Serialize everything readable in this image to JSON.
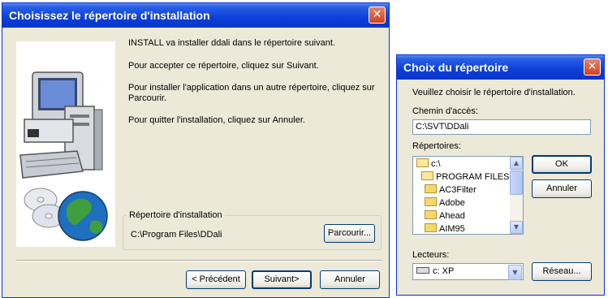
{
  "install_dialog": {
    "title": "Choisissez le répertoire d'installation",
    "close_symbol": "✕",
    "paragraphs": [
      "INSTALL va installer ddali dans le répertoire suivant.",
      "Pour accepter ce répertoire, cliquez sur Suivant.",
      "Pour installer l'application dans un autre répertoire, cliquez sur",
      "Parcourir.",
      "Pour quitter l'installation, cliquez sur Annuler."
    ],
    "group_label": "Répertoire d'installation",
    "install_path": "C:\\Program Files\\DDali",
    "browse_label": "Parcourir...",
    "back_label": "< Précédent",
    "next_label": "Suivant>",
    "cancel_label": "Annuler",
    "illustration": "computer-and-globe-icon"
  },
  "dir_dialog": {
    "title": "Choix du répertoire",
    "close_symbol": "✕",
    "prompt": "Veuillez choisir le répertoire d'installation.",
    "path_label": "Chemin d'accès:",
    "path_value": "C:\\SVT\\DDali",
    "dirs_label": "Répertoires:",
    "directories": [
      "c:\\",
      "PROGRAM FILES",
      "AC3Filter",
      "Adobe",
      "Ahead",
      "AIM95"
    ],
    "drives_label": "Lecteurs:",
    "drive_value": "c: XP",
    "ok_label": "OK",
    "cancel_label": "Annuler",
    "network_label": "Réseau..."
  },
  "colors": {
    "titlebar": "#0a3fd9",
    "dialog_bg": "#ece9d8",
    "close_button": "#d0431e"
  }
}
